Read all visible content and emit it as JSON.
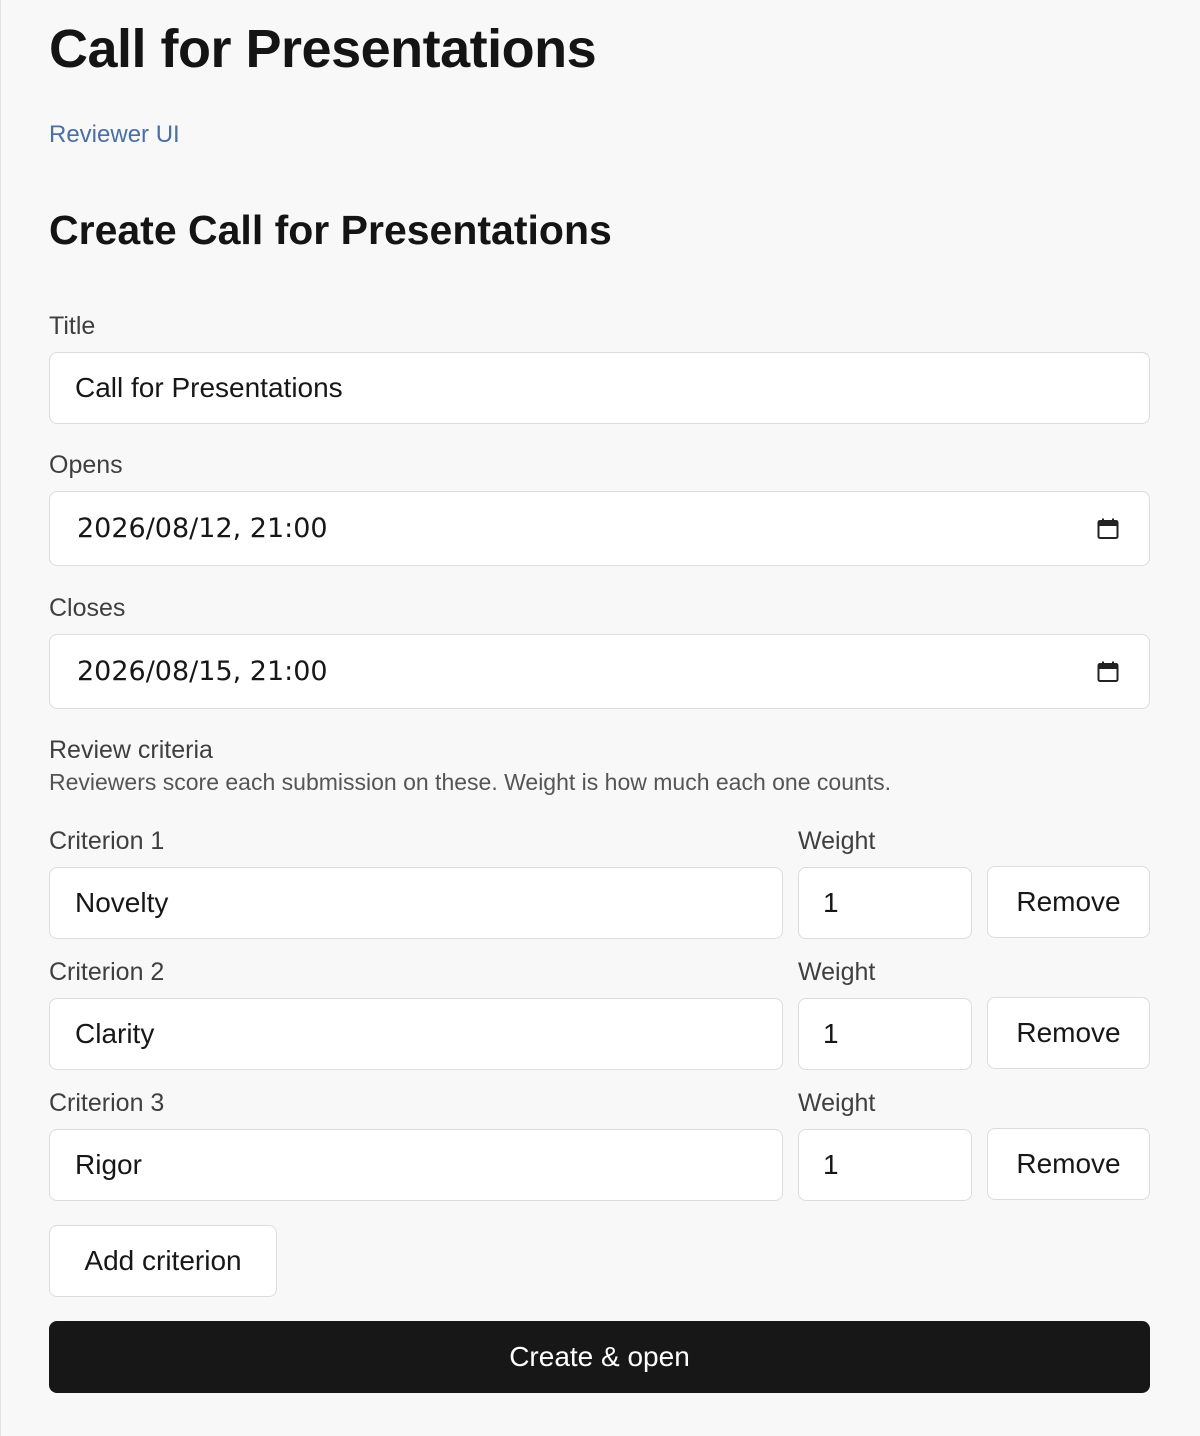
{
  "page": {
    "title": "Call for Presentations",
    "reviewer_link": "Reviewer UI",
    "form_heading": "Create Call for Presentations"
  },
  "form": {
    "title": {
      "label": "Title",
      "value": "Call for Presentations"
    },
    "opens": {
      "label": "Opens",
      "value": "2026/08/12, 21:00"
    },
    "closes": {
      "label": "Closes",
      "value": "2026/08/15, 21:00"
    }
  },
  "criteria": {
    "heading": "Review criteria",
    "hint": "Reviewers score each submission on these. Weight is how much each one counts.",
    "weight_label": "Weight",
    "remove_label": "Remove",
    "items": [
      {
        "label": "Criterion 1",
        "value": "Novelty",
        "weight": "1"
      },
      {
        "label": "Criterion 2",
        "value": "Clarity",
        "weight": "1"
      },
      {
        "label": "Criterion 3",
        "value": "Rigor",
        "weight": "1"
      }
    ],
    "add_label": "Add criterion"
  },
  "submit_label": "Create & open",
  "icons": {
    "date_picker": "calendar-icon"
  },
  "colors": {
    "link": "#4a6fa5",
    "primary_button": "#171717",
    "background": "#f8f8f8"
  }
}
